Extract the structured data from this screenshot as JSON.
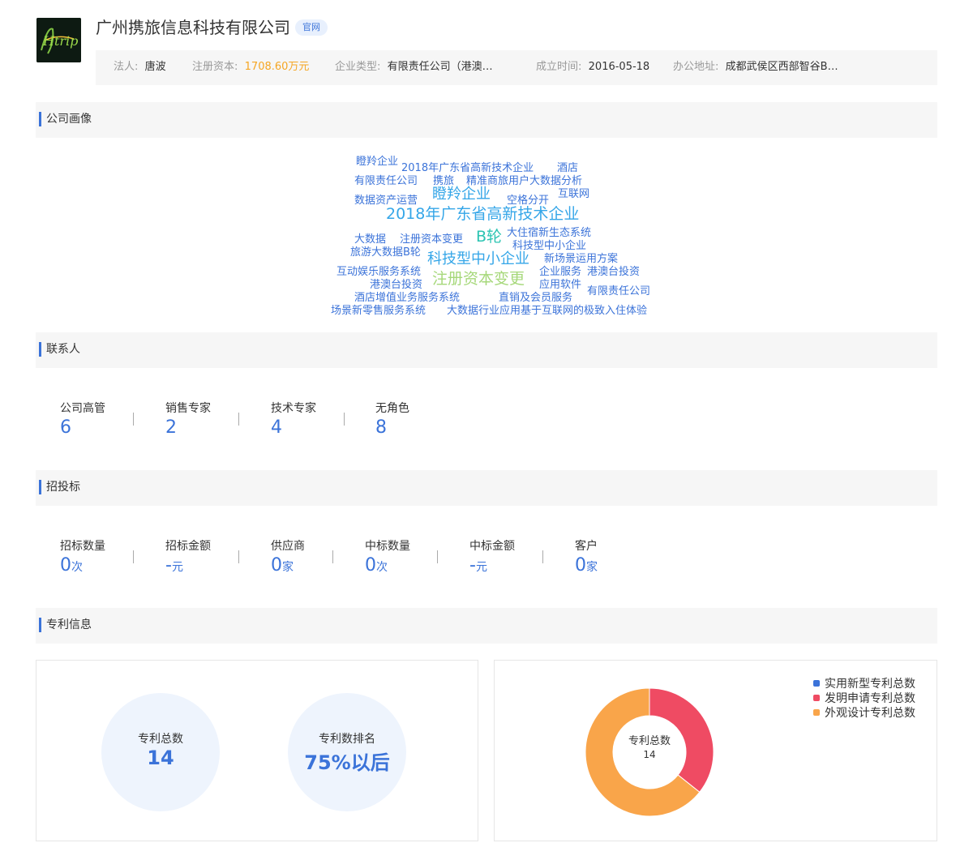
{
  "colors": {
    "accent": "#3b73d9",
    "money": "#f5a623",
    "utility": "#3b73d9",
    "invention": "#ef4b63",
    "design": "#f9a54a"
  },
  "header": {
    "logo_text": "Htrip",
    "company_name": "广州携旅信息科技有限公司",
    "official_badge": "官网",
    "info": [
      {
        "label": "法人:",
        "value": "唐波"
      },
      {
        "label": "注册资本:",
        "value": "1708.60万元"
      },
      {
        "label": "企业类型:",
        "value": "有限责任公司（港澳…"
      },
      {
        "label": "成立时间:",
        "value": "2016-05-18"
      },
      {
        "label": "办公地址:",
        "value": "成都武侯区西部智谷B…"
      }
    ]
  },
  "sections": {
    "profile": "公司画像",
    "contacts": "联系人",
    "bidding": "招投标",
    "patents": "专利信息"
  },
  "word_cloud": [
    "瞪羚企业",
    "2018年广东省高新技术企业",
    "酒店",
    "有限责任公司",
    "携旅",
    "精准商旅用户大数据分析",
    "数据资产运营",
    "瞪羚企业",
    "空格分开",
    "互联网",
    "2018年广东省高新技术企业",
    "大数据",
    "注册资本变更",
    "B轮",
    "大住宿新生态系统",
    "科技型中小企业",
    "旅游大数据B轮",
    "科技型中小企业",
    "新场景运用方案",
    "互动娱乐服务系统",
    "企业服务",
    "港澳台投资",
    "港澳台投资",
    "注册资本变更",
    "应用软件",
    "有限责任公司",
    "酒店增值业务服务系统",
    "直销及会员服务",
    "场景新零售服务系统",
    "大数据行业应用基于互联网的极致入住体验"
  ],
  "contacts": [
    {
      "label": "公司高管",
      "value": "6"
    },
    {
      "label": "销售专家",
      "value": "2"
    },
    {
      "label": "技术专家",
      "value": "4"
    },
    {
      "label": "无角色",
      "value": "8"
    }
  ],
  "bidding": [
    {
      "label": "招标数量",
      "value": "0",
      "unit": "次"
    },
    {
      "label": "招标金额",
      "value": "-",
      "unit": "元"
    },
    {
      "label": "供应商",
      "value": "0",
      "unit": "家"
    },
    {
      "label": "中标数量",
      "value": "0",
      "unit": "次"
    },
    {
      "label": "中标金额",
      "value": "-",
      "unit": "元"
    },
    {
      "label": "客户",
      "value": "0",
      "unit": "家"
    }
  ],
  "patents": {
    "total_label": "专利总数",
    "total_value": "14",
    "rank_label": "专利数排名",
    "rank_value": "75%以后"
  },
  "chart_data": {
    "type": "pie",
    "center_label": "专利总数",
    "center_value": "14",
    "series": [
      {
        "name": "实用新型专利总数",
        "value": 0
      },
      {
        "name": "发明申请专利总数",
        "value": 5
      },
      {
        "name": "外观设计专利总数",
        "value": 9
      }
    ],
    "legend_position": "top-right"
  }
}
